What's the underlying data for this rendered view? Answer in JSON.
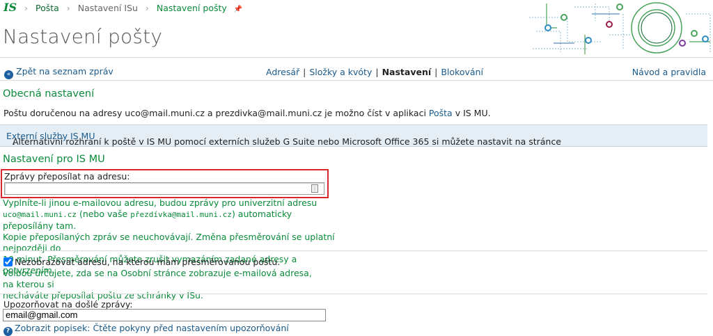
{
  "header": {
    "logo": "IS",
    "breadcrumbs": [
      "Pošta",
      "Nastavení ISu",
      "Nastavení pošty"
    ],
    "title": "Nastavení pošty"
  },
  "nav": {
    "back": "Zpět na seznam zpráv",
    "items": [
      "Adresář",
      "Složky a kvóty",
      "Nastavení",
      "Blokování"
    ],
    "active_index": 2,
    "help": "Návod a pravidla"
  },
  "general": {
    "heading": "Obecná nastavení",
    "p_prefix": "Poštu doručenou na adresy uco@mail.muni.cz a prezdivka@mail.muni.cz je možno číst v aplikaci ",
    "p_link": "Pošta",
    "p_suffix": " v IS MU.",
    "info_prefix": "Alternativní rozhraní k poště v IS MU pomocí externích služeb G Suite nebo Microsoft Office 365 si můžete nastavit na stránce ",
    "info_link": "Externí služby IS MU",
    "info_suffix": "."
  },
  "ismu": {
    "heading": "Nastavení pro IS MU",
    "forward_label": "Zprávy přeposílat na adresu:",
    "forward_value": "",
    "forward_hint_1": "Vyplníte-li jinou e-mailovou adresu, budou zprávy pro univerzitní adresu",
    "forward_hint_code1": "uco@mail.muni.cz",
    "forward_hint_2": " (nebo vaše ",
    "forward_hint_code2": "přezdívka@mail.muni.cz",
    "forward_hint_3": ") automaticky přeposílány tam.",
    "forward_hint_4": "Kopie přeposílaných zpráv se neuchovávají. Změna přesměrování se uplatní nejpozději do",
    "forward_hint_5": "10 minut. Přesměrování můžete zrušit vymazáním zadané adresy a potvrzením.",
    "hide_checkbox_label": "Nezobrazovat adresu, na kterou mám přesměrovanou poštu.",
    "hide_checked": true,
    "hide_hint_1": "Volbou určujete, zda se na Osobní stránce zobrazuje e-mailová adresa, na kterou si",
    "hide_hint_2": "necháváte přeposílat poštu ze schránky v ISu.",
    "notify_label": "Upozorňovat na došlé zprávy:",
    "notify_value": "email@gmail.com",
    "show_hint": "Zobrazit popisek: Čtěte pokyny před nastavením upozorňování"
  },
  "colors": {
    "green": "#0a8a3a",
    "link": "#1a5a8a",
    "highlight": "#d9262c"
  }
}
